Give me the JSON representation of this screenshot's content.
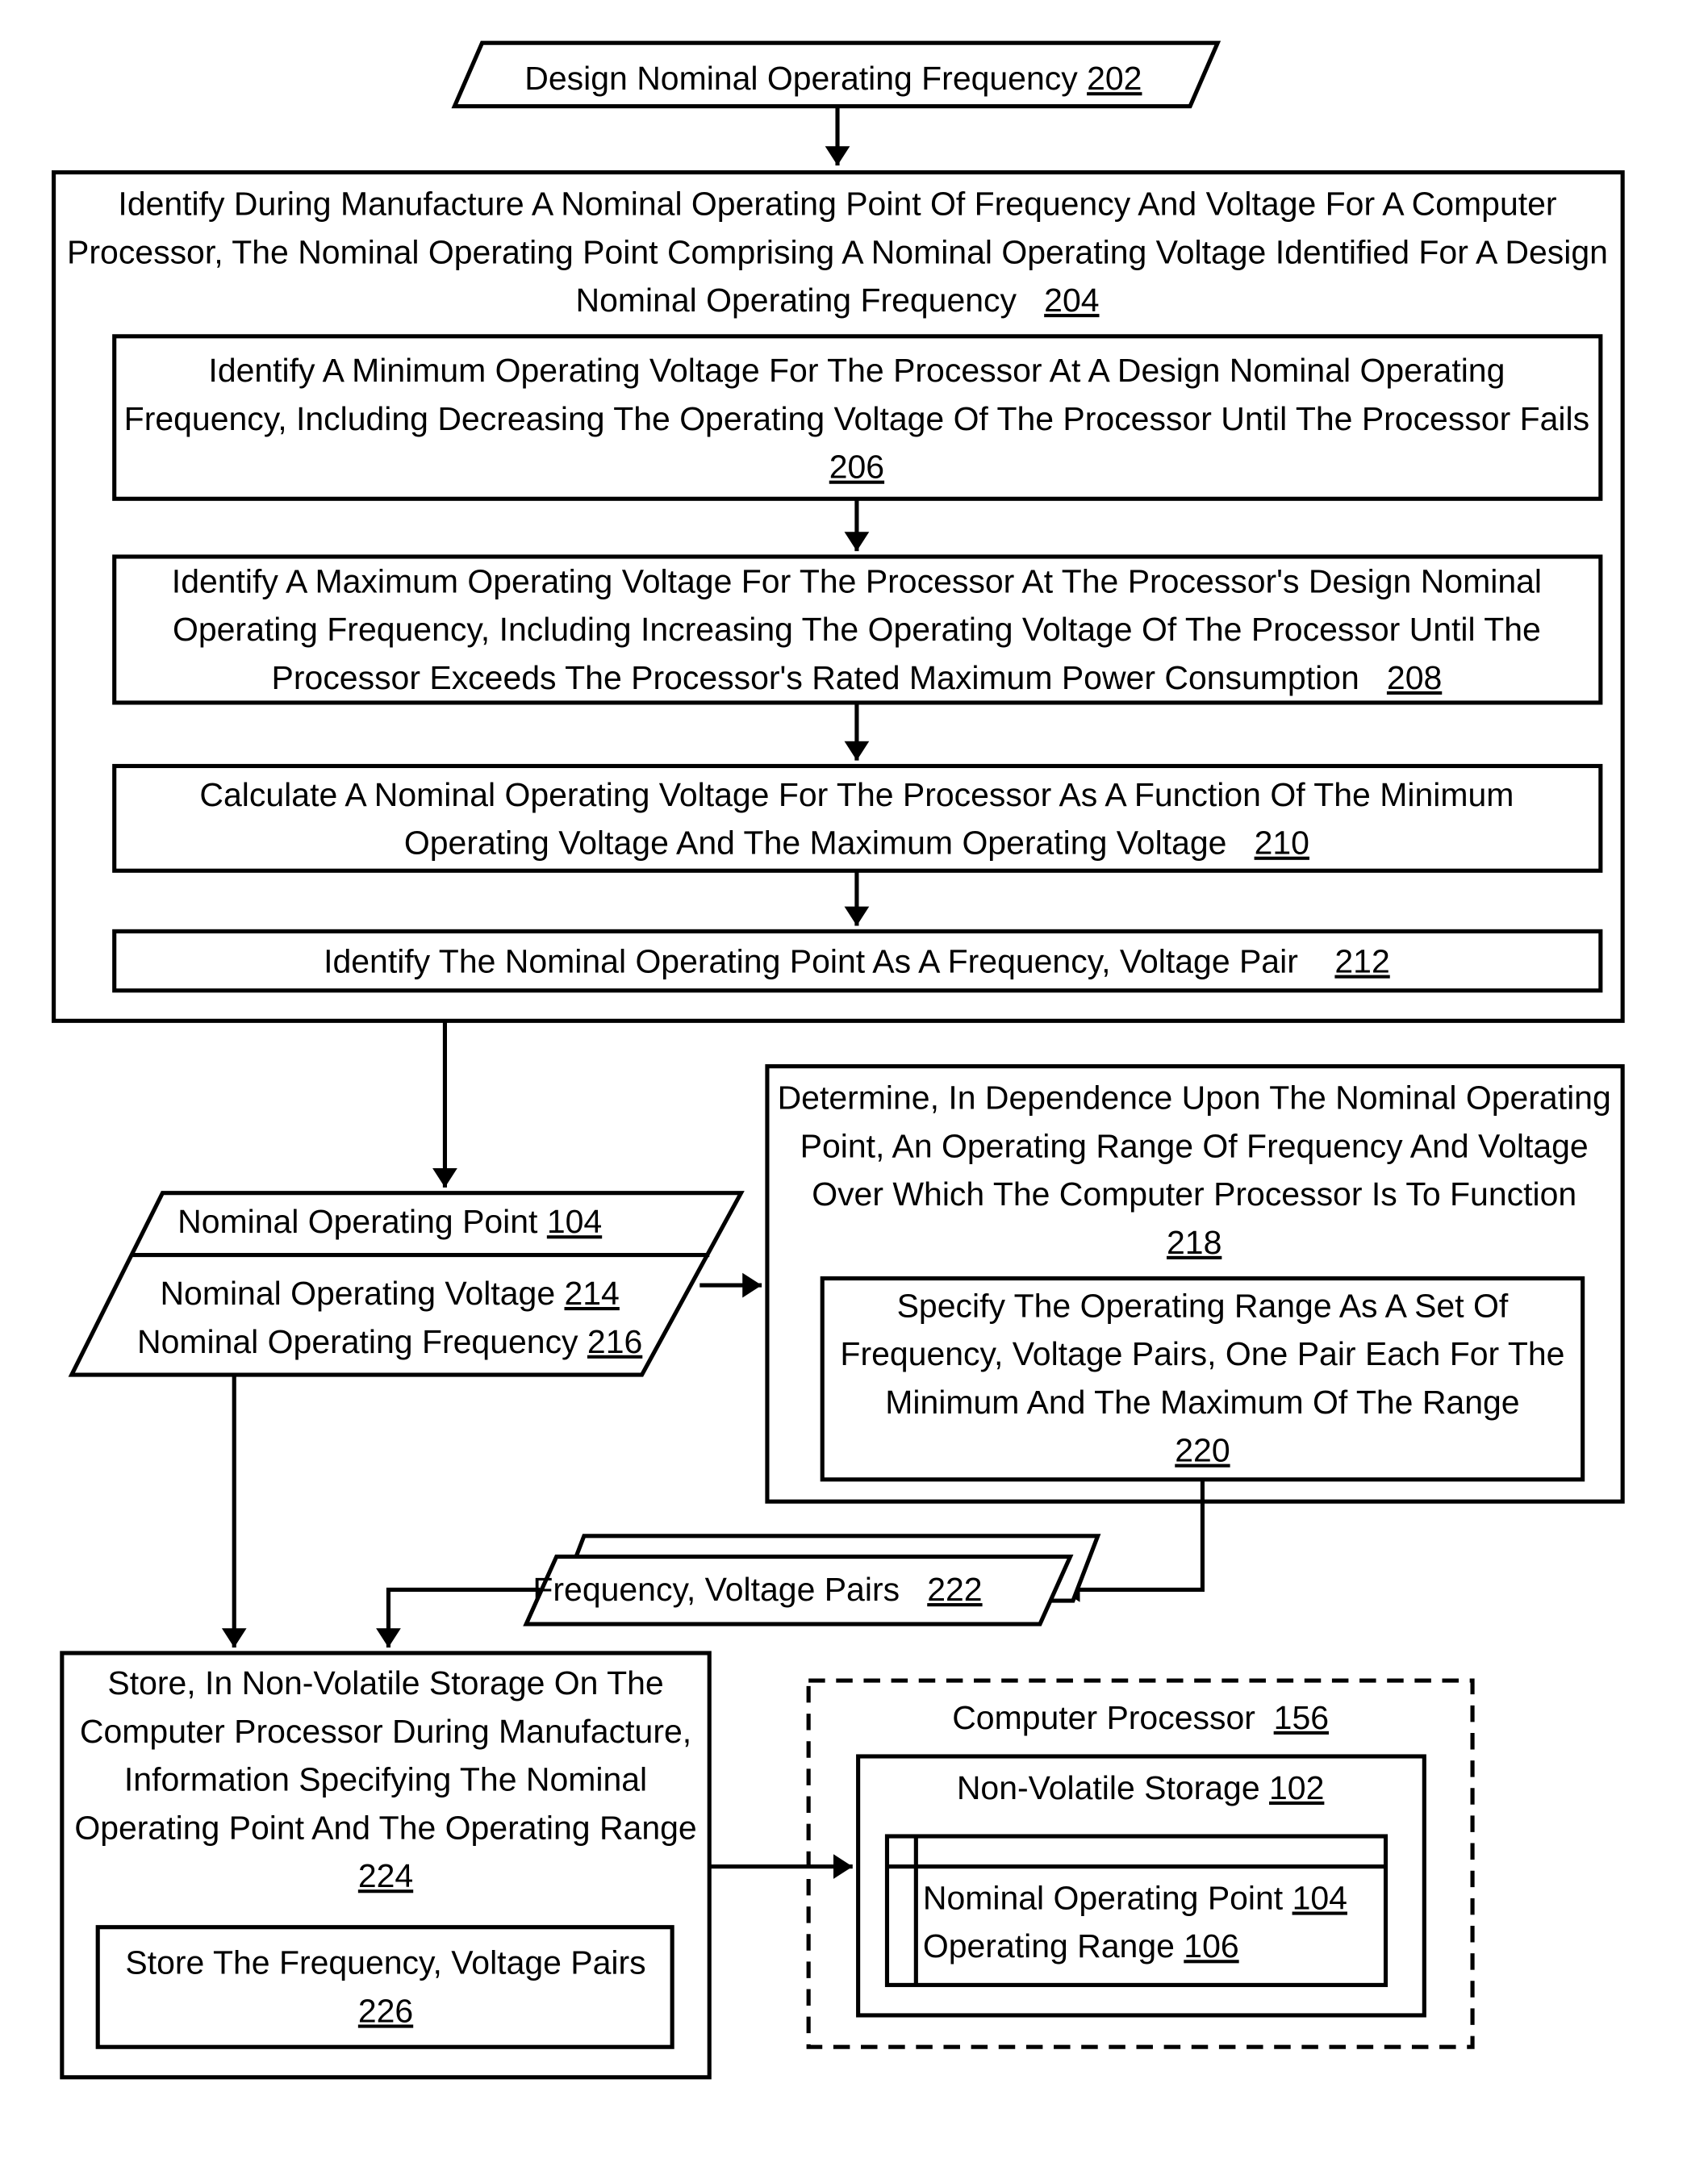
{
  "figure": {
    "input_202": {
      "text": "Design Nominal Operating Frequency ",
      "ref": "202"
    },
    "step_204": {
      "lines": [
        "Identify During Manufacture A Nominal Operating Point Of Frequency And Voltage For A Computer",
        "Processor, The Nominal Operating Point Comprising A Nominal Operating Voltage Identified For A Design",
        "Nominal Operating Frequency   "
      ],
      "ref": "204"
    },
    "step_206": {
      "lines": [
        "Identify A Minimum Operating Voltage For The Processor At A Design Nominal Operating",
        "Frequency, Including Decreasing The Operating Voltage Of The Processor Until The Processor Fails"
      ],
      "ref": "206"
    },
    "step_208": {
      "lines": [
        "Identify A Maximum Operating Voltage For The Processor At The Processor's Design Nominal",
        "Operating Frequency, Including Increasing The Operating Voltage Of The Processor Until The",
        "Processor Exceeds The Processor's Rated Maximum Power Consumption   "
      ],
      "ref": "208"
    },
    "step_210": {
      "lines": [
        "Calculate A Nominal Operating Voltage For The Processor As A Function Of The Minimum",
        "Operating Voltage And The Maximum Operating Voltage   "
      ],
      "ref": "210"
    },
    "step_212": {
      "lines": [
        "Identify The Nominal Operating Point As A Frequency, Voltage Pair    "
      ],
      "ref": "212"
    },
    "data_104": {
      "title": "Nominal Operating Point ",
      "title_ref": "104",
      "line1": "Nominal Operating Voltage ",
      "line1_ref": "214",
      "line2": "Nominal Operating Frequency ",
      "line2_ref": "216"
    },
    "step_218": {
      "lines": [
        "Determine, In Dependence Upon The Nominal Operating",
        "Point, An Operating Range Of Frequency And Voltage",
        "Over Which The Computer Processor Is To Function"
      ],
      "ref": "218"
    },
    "step_220": {
      "lines": [
        "Specify The Operating Range As A Set Of",
        "Frequency, Voltage Pairs, One Pair Each For The",
        "Minimum And The Maximum Of The Range"
      ],
      "ref": "220"
    },
    "data_222": {
      "text": "Frequency, Voltage Pairs   ",
      "ref": "222"
    },
    "step_224": {
      "lines": [
        "Store, In Non-Volatile Storage On The",
        "Computer Processor During Manufacture,",
        "Information Specifying The Nominal",
        "Operating Point And The Operating Range"
      ],
      "ref": "224"
    },
    "step_226": {
      "lines": [
        "Store The Frequency, Voltage Pairs"
      ],
      "ref": "226"
    },
    "processor_156": {
      "text": "Computer Processor  ",
      "ref": "156"
    },
    "storage_102": {
      "text": "Non-Volatile Storage ",
      "ref": "102"
    },
    "record": {
      "line1": "Nominal Operating Point ",
      "line1_ref": "104",
      "line2": "Operating Range ",
      "line2_ref": "106"
    }
  }
}
